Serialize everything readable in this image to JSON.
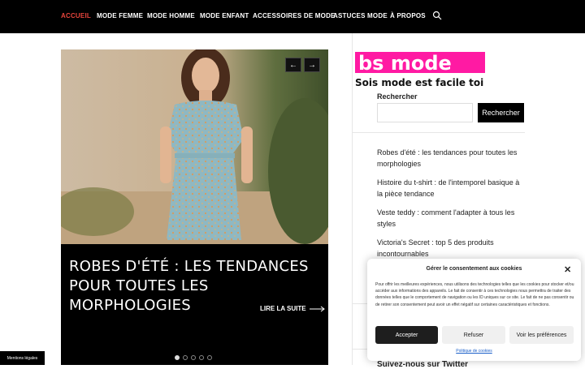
{
  "nav": {
    "items": [
      {
        "label": "ACCUEIL",
        "active": true
      },
      {
        "label": "MODE FEMME"
      },
      {
        "label": "MODE HOMME"
      },
      {
        "label": "MODE ENFANT"
      },
      {
        "label": "ACCESSOIRES DE MODE"
      },
      {
        "label": "ASTUCES MODE"
      },
      {
        "label": "À PROPOS"
      }
    ],
    "search_icon": "search-icon"
  },
  "slider": {
    "title": "ROBES D'ÉTÉ : LES TENDANCES POUR TOUTES LES MORPHOLOGIES",
    "read_more": "LIRE LA SUITE",
    "prev_icon": "arrow-left-icon",
    "next_icon": "arrow-right-icon",
    "slide_count": 5,
    "active_slide": 1
  },
  "sidebar": {
    "logo": {
      "name": "bs mode",
      "tagline": "Sois mode est facile toi"
    },
    "search": {
      "label": "Rechercher",
      "placeholder": "",
      "button": "Rechercher"
    },
    "recent_posts": [
      "Robes d'été : les tendances pour toutes les morphologies",
      "Histoire du t-shirt : de l'intemporel basique à la pièce tendance",
      "Veste teddy : comment l'adapter à tous les styles",
      "Victoria's Secret : top 5 des produits incontournables"
    ],
    "twitter_heading": "Suivez-nous sur Twitter"
  },
  "footer": {
    "legal": "Mentions légales"
  },
  "cookie": {
    "title": "Gérer le consentement aux cookies",
    "text": "Pour offrir les meilleures expériences, nous utilisons des technologies telles que les cookies pour stocker et/ou accéder aux informations des appareils. Le fait de consentir à ces technologies nous permettra de traiter des données telles que le comportement de navigation ou les ID uniques sur ce site. Le fait de ne pas consentir ou de retirer son consentement peut avoir un effet négatif sur certaines caractéristiques et fonctions.",
    "accept": "Accepter",
    "refuse": "Refuser",
    "preferences": "Voir les préférences",
    "policy": "Politique de cookies"
  },
  "colors": {
    "nav_bg": "#000000",
    "accent": "#e8453c",
    "logo_pink": "#ff1aa3"
  }
}
